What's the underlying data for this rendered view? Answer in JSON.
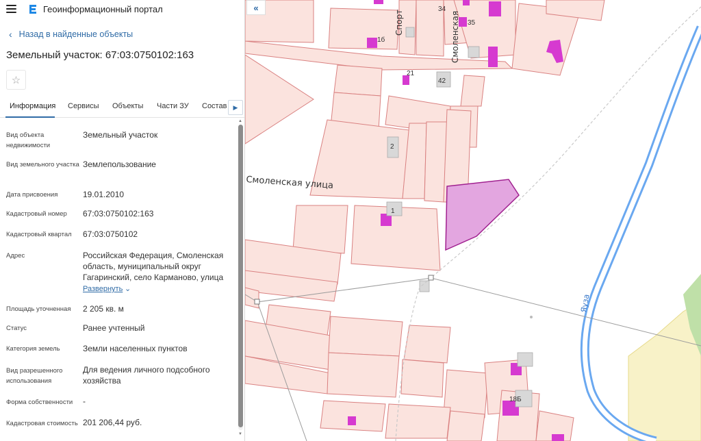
{
  "app": {
    "title": "Геоинформационный портал"
  },
  "nav": {
    "back_label": "Назад в найденные объекты"
  },
  "object": {
    "title": "Земельный участок: 67:03:0750102:163"
  },
  "tabs": [
    {
      "label": "Информация"
    },
    {
      "label": "Сервисы"
    },
    {
      "label": "Объекты"
    },
    {
      "label": "Части ЗУ"
    },
    {
      "label": "Состав"
    }
  ],
  "props": [
    {
      "label": "Вид объекта недвижимости",
      "value": "Земельный участок"
    },
    {
      "label": "Вид земельного участка",
      "value": "Землепользование"
    },
    {
      "label": "Дата присвоения",
      "value": "19.01.2010"
    },
    {
      "label": "Кадастровый номер",
      "value": "67:03:0750102:163"
    },
    {
      "label": "Кадастровый квартал",
      "value": "67:03:0750102"
    },
    {
      "label": "Адрес",
      "value": "Российская Федерация, Смоленская область, муниципальный округ Гагаринский, село Карманово, улица"
    },
    {
      "label": "Площадь уточненная",
      "value": "2 205 кв. м"
    },
    {
      "label": "Статус",
      "value": "Ранее учтенный"
    },
    {
      "label": "Категория земель",
      "value": "Земли населенных пунктов"
    },
    {
      "label": "Вид разрешенного использования",
      "value": "Для ведения личного подсобного хозяйства"
    },
    {
      "label": "Форма собственности",
      "value": "-"
    },
    {
      "label": "Кадастровая стоимость",
      "value": "201 206,44 руб."
    }
  ],
  "expand_label": "Развернуть",
  "map": {
    "street_smolenskaya": "Смоленская  улица",
    "street_smolenskaya_vert": "Смоленская",
    "street_sport": "Спорт",
    "river": "Яуза",
    "house_numbers": [
      "34",
      "35",
      "1б",
      "21",
      "42",
      "2",
      "1",
      "18Б"
    ],
    "colors": {
      "parcel_fill": "#fbe3de",
      "parcel_stroke": "#d98080",
      "building": "#d63ad0",
      "selected_fill": "#e3a6e0",
      "selected_stroke": "#a0208f",
      "river": "#6aa8f0",
      "road": "#f6d7d2"
    }
  }
}
